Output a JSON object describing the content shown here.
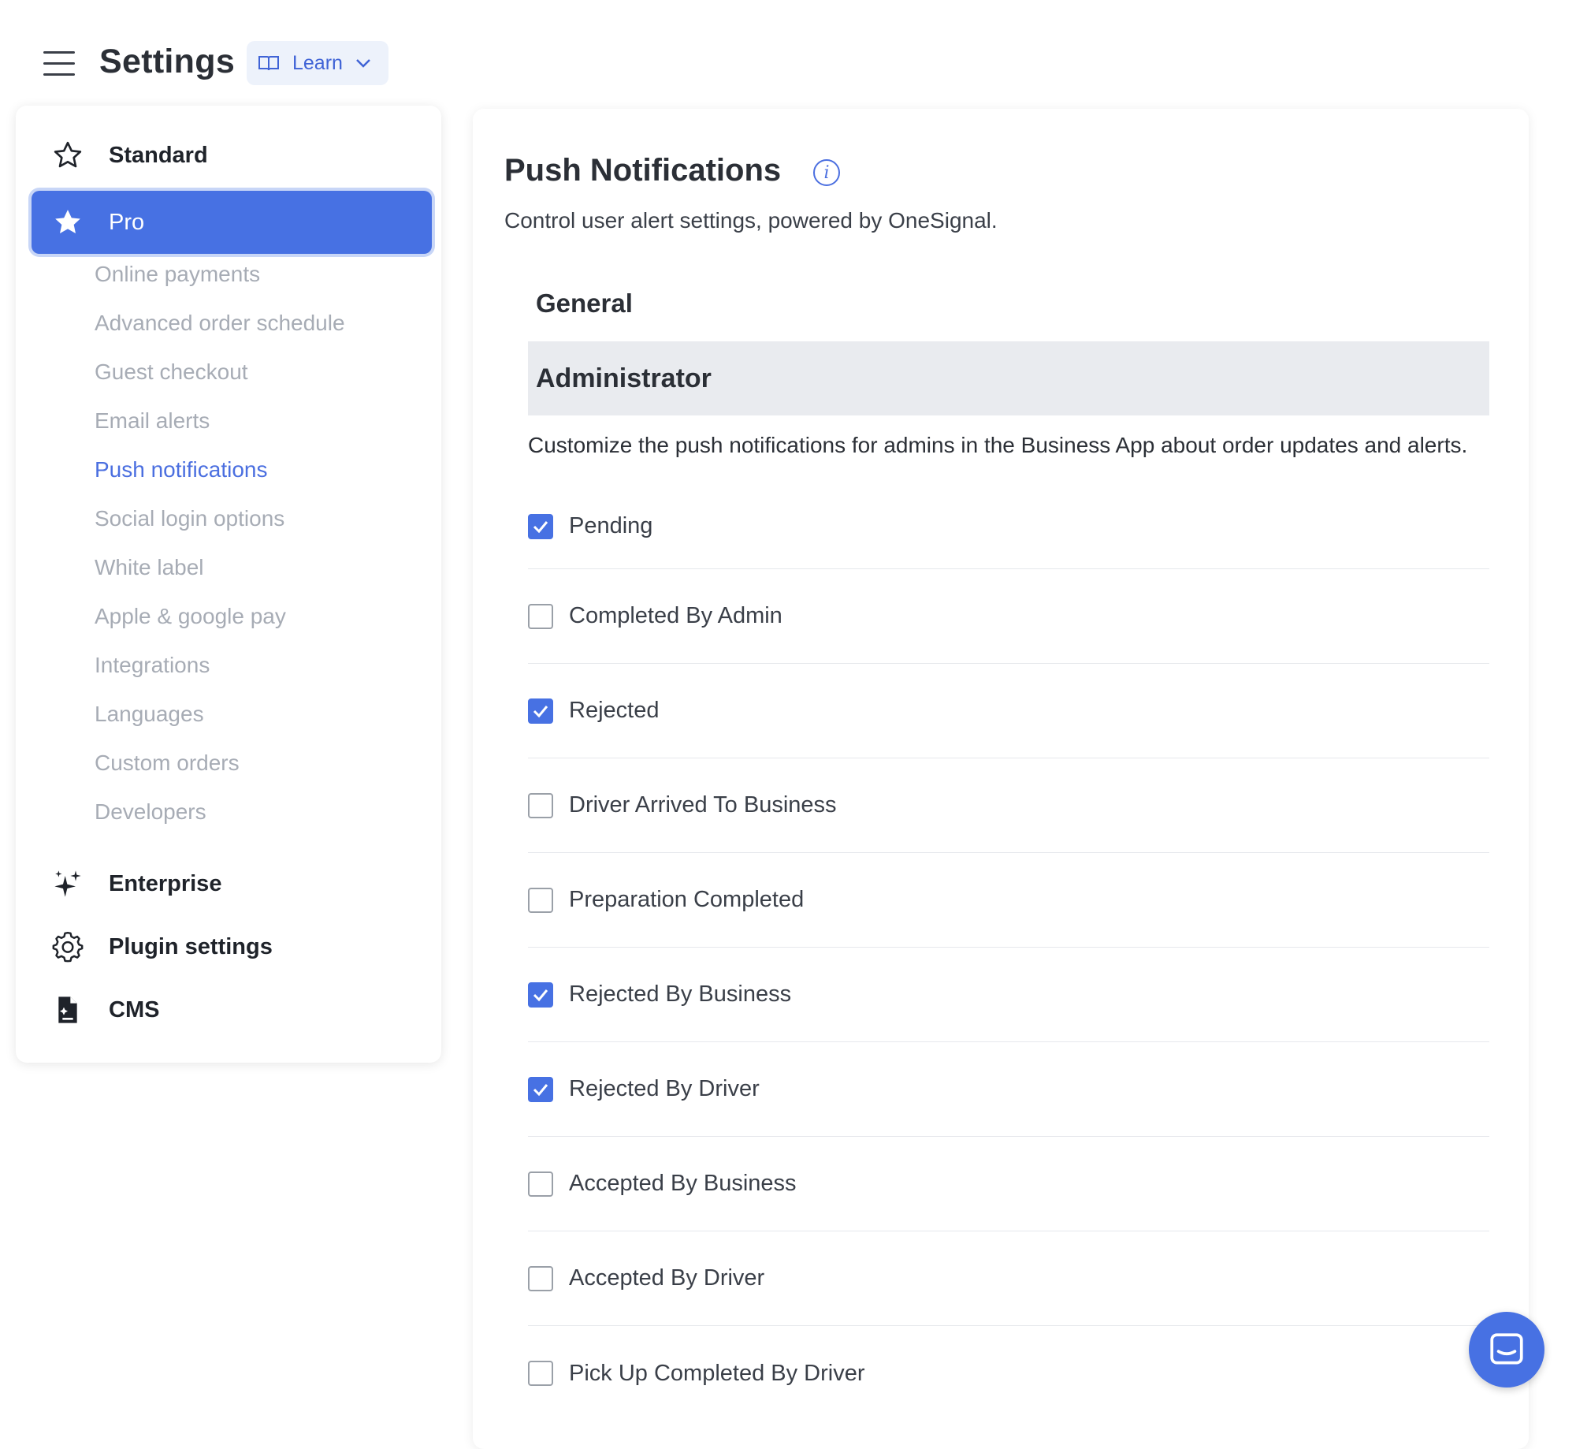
{
  "header": {
    "title": "Settings",
    "learn_label": "Learn"
  },
  "sidebar": {
    "standard_label": "Standard",
    "pro_label": "Pro",
    "pro_items": [
      {
        "label": "Online payments",
        "active": false
      },
      {
        "label": "Advanced order schedule",
        "active": false
      },
      {
        "label": "Guest checkout",
        "active": false
      },
      {
        "label": "Email alerts",
        "active": false
      },
      {
        "label": "Push notifications",
        "active": true
      },
      {
        "label": "Social login options",
        "active": false
      },
      {
        "label": "White label",
        "active": false
      },
      {
        "label": "Apple & google pay",
        "active": false
      },
      {
        "label": "Integrations",
        "active": false
      },
      {
        "label": "Languages",
        "active": false
      },
      {
        "label": "Custom orders",
        "active": false
      },
      {
        "label": "Developers",
        "active": false
      }
    ],
    "enterprise_label": "Enterprise",
    "plugin_label": "Plugin settings",
    "cms_label": "CMS"
  },
  "main": {
    "title": "Push Notifications",
    "description": "Control user alert settings, powered by OneSignal.",
    "section_general": "General",
    "admin_title": "Administrator",
    "admin_description": "Customize the push notifications for admins in the Business App about order updates and alerts.",
    "options": [
      {
        "label": "Pending",
        "checked": true
      },
      {
        "label": "Completed By Admin",
        "checked": false
      },
      {
        "label": "Rejected",
        "checked": true
      },
      {
        "label": "Driver Arrived To Business",
        "checked": false
      },
      {
        "label": "Preparation Completed",
        "checked": false
      },
      {
        "label": "Rejected By Business",
        "checked": true
      },
      {
        "label": "Rejected By Driver",
        "checked": true
      },
      {
        "label": "Accepted By Business",
        "checked": false
      },
      {
        "label": "Accepted By Driver",
        "checked": false
      },
      {
        "label": "Pick Up Completed By Driver",
        "checked": false
      }
    ]
  },
  "colors": {
    "accent": "#4771e3",
    "muted_text": "#a7acb5",
    "band": "#e9ebef"
  },
  "icons": {
    "menu": "hamburger-menu-icon",
    "learn": "book-icon",
    "standard": "star-outline-icon",
    "pro": "star-filled-icon",
    "enterprise": "sparkles-icon",
    "plugin": "gear-icon",
    "cms": "document-icon",
    "info": "info-icon",
    "chat": "chat-icon"
  }
}
